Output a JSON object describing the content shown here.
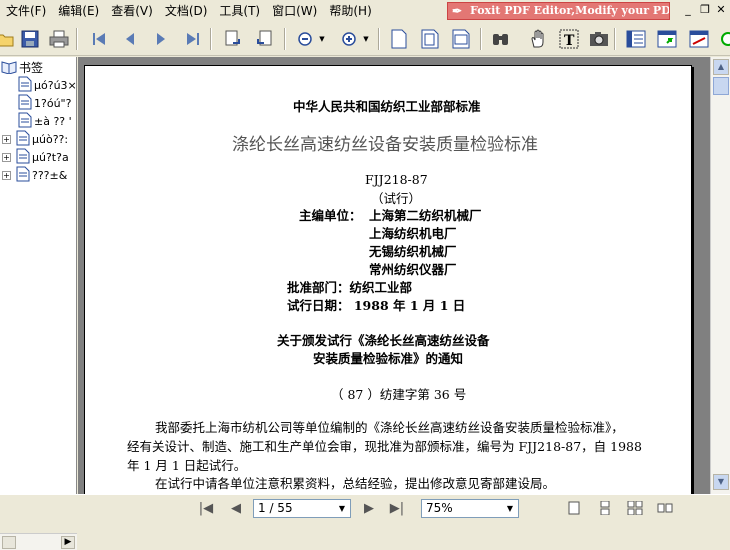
{
  "menu": [
    "文件(F)",
    "编辑(E)",
    "查看(V)",
    "文档(D)",
    "工具(T)",
    "窗口(W)",
    "帮助(H)"
  ],
  "promo": "Foxit PDF Editor,Modify your PDF!",
  "sidebar": {
    "root": "书签",
    "items": [
      "µó?ú3×",
      "1?óú\"?",
      "±à ?? '",
      "µúò??:",
      "µú?t?a",
      "???±&"
    ]
  },
  "document": {
    "org": "中华人民共和国纺织工业部部标准",
    "title": "涤纶长丝高速纺丝设备安装质量检验标准",
    "code": "FJJ218-87",
    "trial": "（试行）",
    "editor_label": "主编单位：",
    "editors": [
      "上海第二纺织机械厂",
      "上海纺织机电厂",
      "无锡纺织机械厂",
      "常州纺织仪器厂"
    ],
    "approval": "批准部门：纺织工业部",
    "trial_date": "试行日期： 1988 年 1 月 1 日",
    "notice_title_1": "关于颁发试行《涤纶长丝高速纺丝设备",
    "notice_title_2": "安装质量检验标准》的通知",
    "doc_number": "（ 87 ）纺建字第 36 号",
    "body_1": "我部委托上海市纺机公司等单位编制的《涤纶长丝高速纺丝设备安装质量检验标准》，",
    "body_2": "经有关设计、制造、施工和生产单位会审，现批准为部颁标准，编号为 FJJ218-87，自 1988",
    "body_3": "年 1 月 1 日起试行。",
    "body_4": "在试行中请各单位注意积累资料，总结经验，提出修改意见寄部建设局。"
  },
  "status": {
    "page": "1 / 55",
    "zoom": "75%"
  }
}
